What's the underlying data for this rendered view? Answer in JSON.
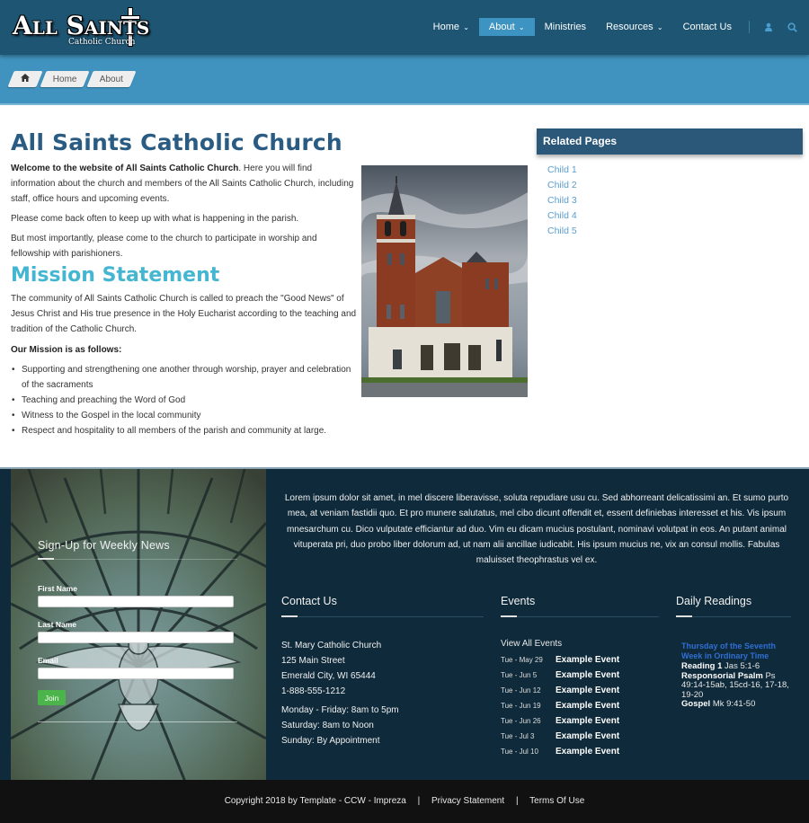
{
  "header": {
    "logo_main": "All Saints",
    "logo_sub": "Catholic Church",
    "nav": [
      {
        "label": "Home",
        "has_dropdown": true,
        "active": false
      },
      {
        "label": "About",
        "has_dropdown": true,
        "active": true
      },
      {
        "label": "Ministries",
        "has_dropdown": false,
        "active": false
      },
      {
        "label": "Resources",
        "has_dropdown": true,
        "active": false
      },
      {
        "label": "Contact Us",
        "has_dropdown": false,
        "active": false
      }
    ],
    "icons": {
      "user": "user-icon",
      "search": "search-icon"
    },
    "caret": "⌄"
  },
  "breadcrumb": {
    "home_icon": "home-icon",
    "items": [
      "Home",
      "About"
    ]
  },
  "main": {
    "title": "All Saints Catholic Church",
    "welcome_bold": "Welcome to the website of All Saints Catholic Church",
    "welcome_rest": ". Here you will find information about the church and members of the All Saints Catholic Church, including staff, office hours and upcoming events.",
    "p2": "Please come back often to keep up with what is happening in the parish.",
    "p3": "But most importantly, please come to the church to participate in worship and fellowship with parishioners.",
    "mission_title": "Mission Statement",
    "mission_text": "The community of All Saints Catholic Church is called to preach the \"Good News\" of Jesus Christ and His true presence in the Holy Eucharist according to the teaching and tradition of the Catholic Church.",
    "mission_subhead": "Our Mission is as follows:",
    "mission_items": [
      "Supporting and strengthening one another through worship, prayer and celebration of the sacraments",
      "Teaching and preaching the Word of God",
      "Witness to the Gospel in the local community",
      "Respect and hospitality to all members of the parish and community at large."
    ],
    "photo_alt": "church-photo"
  },
  "sidebar": {
    "title": "Related Pages",
    "links": [
      "Child 1",
      "Child 2",
      "Child 3",
      "Child 4",
      "Child 5"
    ]
  },
  "footer": {
    "signup": {
      "title": "Sign-Up for Weekly News",
      "first_name_label": "First Name",
      "first_name_value": "",
      "last_name_label": "Last Name",
      "last_name_value": "",
      "email_label": "Email",
      "email_value": "",
      "join_label": "Join"
    },
    "lorem": "Lorem ipsum dolor sit amet, in mel discere liberavisse, soluta repudiare usu cu. Sed abhorreant delicatissimi an. Et sumo purto mea, at veniam fastidii quo. Et pro munere salutatus, mel cibo dicunt offendit et, essent definiebas interesset et his. Vis ipsum mnesarchum cu. Dico vulputate efficiantur ad duo. Vim eu dicam mucius postulant, nominavi volutpat in eos. An putant animal vituperata pri, duo probo liber dolorum ad, ut nam alii ancillae iudicabit. His ipsum mucius ne, vix an consul mollis. Fabulas maluisset theophrastus vel ex.",
    "contact": {
      "title": "Contact Us",
      "lines": [
        "St. Mary Catholic Church",
        "125 Main Street",
        "Emerald City, WI  65444",
        "1-888-555-1212"
      ],
      "hours": [
        "Monday - Friday: 8am to 5pm",
        "Saturday: 8am to Noon",
        "Sunday: By Appointment"
      ]
    },
    "events": {
      "title": "Events",
      "view_all": "View All Events",
      "items": [
        {
          "date": "Tue - May 29",
          "name": "Example Event"
        },
        {
          "date": "Tue - Jun 5",
          "name": "Example Event"
        },
        {
          "date": "Tue - Jun 12",
          "name": "Example Event"
        },
        {
          "date": "Tue - Jun 19",
          "name": "Example Event"
        },
        {
          "date": "Tue - Jun 26",
          "name": "Example Event"
        },
        {
          "date": "Tue - Jul 3",
          "name": "Example Event"
        },
        {
          "date": "Tue - Jul 10",
          "name": "Example Event"
        }
      ]
    },
    "readings": {
      "title": "Daily Readings",
      "day": "Thursday of the Seventh Week in Ordinary Time",
      "reading1_label": "Reading 1",
      "reading1_ref": " Jas 5:1-6",
      "psalm_label": "Responsorial Psalm",
      "psalm_ref": " Ps 49:14-15ab, 15cd-16, 17-18, 19-20",
      "gospel_label": "Gospel",
      "gospel_ref": " Mk 9:41-50"
    }
  },
  "bottom": {
    "copyright": "Copyright 2018 by Template - CCW - Impreza",
    "separator": "|",
    "privacy": "Privacy Statement",
    "terms": "Terms Of Use"
  },
  "colors": {
    "header_bg": "#1d5573",
    "nav_active": "#3d93c1",
    "breadcrumb_band": "#4193bf",
    "title_blue": "#2a5c83",
    "mission_teal": "#45b6d1",
    "sidebar_head": "#2b5779",
    "link_blue": "#5a9fd0",
    "footer_bg": "#0f2a3a",
    "join_green": "#4bb54b",
    "readings_title": "#2f6fd3",
    "bottom_bar": "#111111"
  }
}
